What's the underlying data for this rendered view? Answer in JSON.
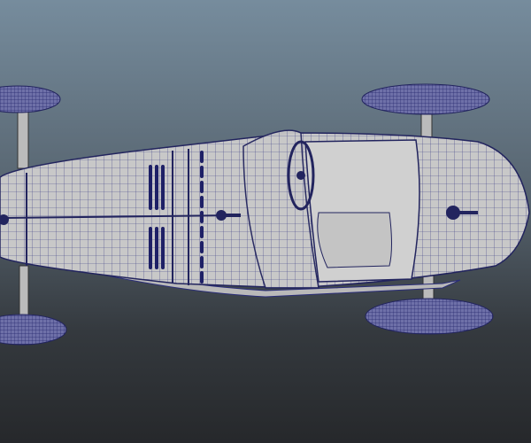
{
  "viewport": {
    "background_top": "#768c9d",
    "background_bottom": "#26282b",
    "model_color": "#c9c9c9",
    "wire_color": "#2c2f7a"
  }
}
